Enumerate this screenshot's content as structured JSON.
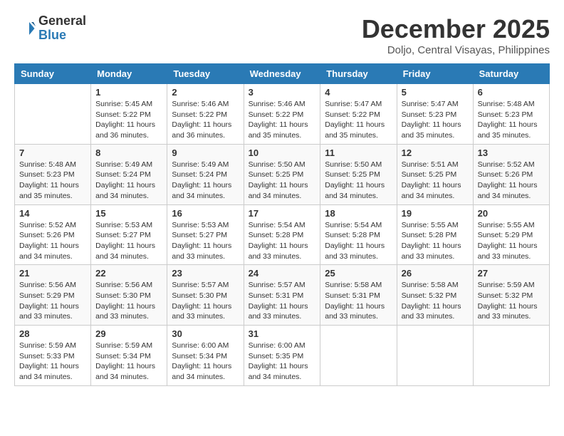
{
  "header": {
    "logo_general": "General",
    "logo_blue": "Blue",
    "month": "December 2025",
    "location": "Doljo, Central Visayas, Philippines"
  },
  "weekdays": [
    "Sunday",
    "Monday",
    "Tuesday",
    "Wednesday",
    "Thursday",
    "Friday",
    "Saturday"
  ],
  "weeks": [
    [
      {
        "day": "",
        "info": ""
      },
      {
        "day": "1",
        "info": "Sunrise: 5:45 AM\nSunset: 5:22 PM\nDaylight: 11 hours\nand 36 minutes."
      },
      {
        "day": "2",
        "info": "Sunrise: 5:46 AM\nSunset: 5:22 PM\nDaylight: 11 hours\nand 36 minutes."
      },
      {
        "day": "3",
        "info": "Sunrise: 5:46 AM\nSunset: 5:22 PM\nDaylight: 11 hours\nand 35 minutes."
      },
      {
        "day": "4",
        "info": "Sunrise: 5:47 AM\nSunset: 5:22 PM\nDaylight: 11 hours\nand 35 minutes."
      },
      {
        "day": "5",
        "info": "Sunrise: 5:47 AM\nSunset: 5:23 PM\nDaylight: 11 hours\nand 35 minutes."
      },
      {
        "day": "6",
        "info": "Sunrise: 5:48 AM\nSunset: 5:23 PM\nDaylight: 11 hours\nand 35 minutes."
      }
    ],
    [
      {
        "day": "7",
        "info": "Sunrise: 5:48 AM\nSunset: 5:23 PM\nDaylight: 11 hours\nand 35 minutes."
      },
      {
        "day": "8",
        "info": "Sunrise: 5:49 AM\nSunset: 5:24 PM\nDaylight: 11 hours\nand 34 minutes."
      },
      {
        "day": "9",
        "info": "Sunrise: 5:49 AM\nSunset: 5:24 PM\nDaylight: 11 hours\nand 34 minutes."
      },
      {
        "day": "10",
        "info": "Sunrise: 5:50 AM\nSunset: 5:25 PM\nDaylight: 11 hours\nand 34 minutes."
      },
      {
        "day": "11",
        "info": "Sunrise: 5:50 AM\nSunset: 5:25 PM\nDaylight: 11 hours\nand 34 minutes."
      },
      {
        "day": "12",
        "info": "Sunrise: 5:51 AM\nSunset: 5:25 PM\nDaylight: 11 hours\nand 34 minutes."
      },
      {
        "day": "13",
        "info": "Sunrise: 5:52 AM\nSunset: 5:26 PM\nDaylight: 11 hours\nand 34 minutes."
      }
    ],
    [
      {
        "day": "14",
        "info": "Sunrise: 5:52 AM\nSunset: 5:26 PM\nDaylight: 11 hours\nand 34 minutes."
      },
      {
        "day": "15",
        "info": "Sunrise: 5:53 AM\nSunset: 5:27 PM\nDaylight: 11 hours\nand 34 minutes."
      },
      {
        "day": "16",
        "info": "Sunrise: 5:53 AM\nSunset: 5:27 PM\nDaylight: 11 hours\nand 33 minutes."
      },
      {
        "day": "17",
        "info": "Sunrise: 5:54 AM\nSunset: 5:28 PM\nDaylight: 11 hours\nand 33 minutes."
      },
      {
        "day": "18",
        "info": "Sunrise: 5:54 AM\nSunset: 5:28 PM\nDaylight: 11 hours\nand 33 minutes."
      },
      {
        "day": "19",
        "info": "Sunrise: 5:55 AM\nSunset: 5:28 PM\nDaylight: 11 hours\nand 33 minutes."
      },
      {
        "day": "20",
        "info": "Sunrise: 5:55 AM\nSunset: 5:29 PM\nDaylight: 11 hours\nand 33 minutes."
      }
    ],
    [
      {
        "day": "21",
        "info": "Sunrise: 5:56 AM\nSunset: 5:29 PM\nDaylight: 11 hours\nand 33 minutes."
      },
      {
        "day": "22",
        "info": "Sunrise: 5:56 AM\nSunset: 5:30 PM\nDaylight: 11 hours\nand 33 minutes."
      },
      {
        "day": "23",
        "info": "Sunrise: 5:57 AM\nSunset: 5:30 PM\nDaylight: 11 hours\nand 33 minutes."
      },
      {
        "day": "24",
        "info": "Sunrise: 5:57 AM\nSunset: 5:31 PM\nDaylight: 11 hours\nand 33 minutes."
      },
      {
        "day": "25",
        "info": "Sunrise: 5:58 AM\nSunset: 5:31 PM\nDaylight: 11 hours\nand 33 minutes."
      },
      {
        "day": "26",
        "info": "Sunrise: 5:58 AM\nSunset: 5:32 PM\nDaylight: 11 hours\nand 33 minutes."
      },
      {
        "day": "27",
        "info": "Sunrise: 5:59 AM\nSunset: 5:32 PM\nDaylight: 11 hours\nand 33 minutes."
      }
    ],
    [
      {
        "day": "28",
        "info": "Sunrise: 5:59 AM\nSunset: 5:33 PM\nDaylight: 11 hours\nand 34 minutes."
      },
      {
        "day": "29",
        "info": "Sunrise: 5:59 AM\nSunset: 5:34 PM\nDaylight: 11 hours\nand 34 minutes."
      },
      {
        "day": "30",
        "info": "Sunrise: 6:00 AM\nSunset: 5:34 PM\nDaylight: 11 hours\nand 34 minutes."
      },
      {
        "day": "31",
        "info": "Sunrise: 6:00 AM\nSunset: 5:35 PM\nDaylight: 11 hours\nand 34 minutes."
      },
      {
        "day": "",
        "info": ""
      },
      {
        "day": "",
        "info": ""
      },
      {
        "day": "",
        "info": ""
      }
    ]
  ]
}
